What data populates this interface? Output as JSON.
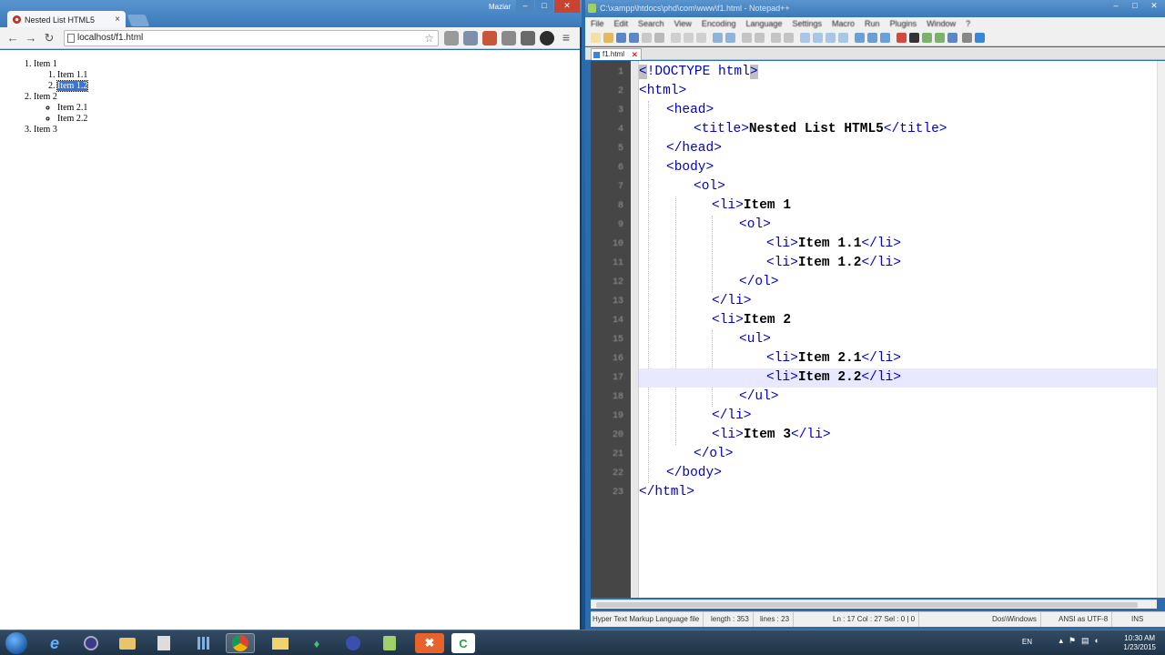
{
  "browser": {
    "tab_title": "Nested List HTML5",
    "tab_close": "×",
    "user_label": "Maziar",
    "address": "localhost/f1.html",
    "page": {
      "items": [
        {
          "label": "Item 1",
          "children_type": "ol",
          "children": [
            "Item 1.1",
            "Item 1.2"
          ]
        },
        {
          "label": "Item 2",
          "children_type": "ul",
          "children": [
            "Item 2.1",
            "Item 2.2"
          ]
        },
        {
          "label": "Item 3"
        }
      ],
      "selected_text": "Item 1.2"
    }
  },
  "editor": {
    "title": "C:\\xampp\\htdocs\\phd\\com\\www\\f1.html - Notepad++",
    "menu": [
      "File",
      "Edit",
      "Search",
      "View",
      "Encoding",
      "Language",
      "Settings",
      "Macro",
      "Run",
      "Plugins",
      "Window",
      "?"
    ],
    "doc_tab": "f1.html",
    "code": {
      "l1_open": "<",
      "l1_bang": "!",
      "l1_rest": "DOCTYPE html",
      "l1_close": ">",
      "l2": "<html>",
      "l3": "<head>",
      "l4_open": "<title>",
      "l4_text": "Nested List HTML5",
      "l4_close": "</title>",
      "l5": "</head>",
      "l6": "<body>",
      "l7": "<ol>",
      "l8_open": "<li>",
      "l8_text": "Item 1",
      "l9": "<ol>",
      "l10_open": "<li>",
      "l10_text": "Item 1.1",
      "l10_close": "</li>",
      "l11_open": "<li>",
      "l11_text": "Item 1.2",
      "l11_close": "</li>",
      "l12": "</ol>",
      "l13": "</li>",
      "l14_open": "<li>",
      "l14_text": "Item 2",
      "l15": "<ul>",
      "l16_open": "<li>",
      "l16_text": "Item 2.1",
      "l16_close": "</li>",
      "l17_open": "<li>",
      "l17_text": "Item 2.2",
      "l17_close": "</li>",
      "l18": "</ul>",
      "l19": "</li>",
      "l20_open": "<li>",
      "l20_text": "Item 3",
      "l20_close": "</li>",
      "l21": "</ol>",
      "l22": "</body>",
      "l23": "</html>"
    },
    "status": {
      "file_type": "Hyper Text Markup Language file",
      "length": "length : 353",
      "lines": "lines : 23",
      "position": "Ln : 17    Col : 27    Sel : 0 | 0",
      "eol": "Dos\\Windows",
      "encoding": "ANSI as UTF-8",
      "mode": "INS"
    }
  },
  "taskbar": {
    "lang": "EN",
    "time": "10:30 AM",
    "date": "1/23/2015"
  },
  "colors": {
    "tag": "#0000c8",
    "selection": "#3875d7",
    "current_line": "#e8e8ff"
  }
}
